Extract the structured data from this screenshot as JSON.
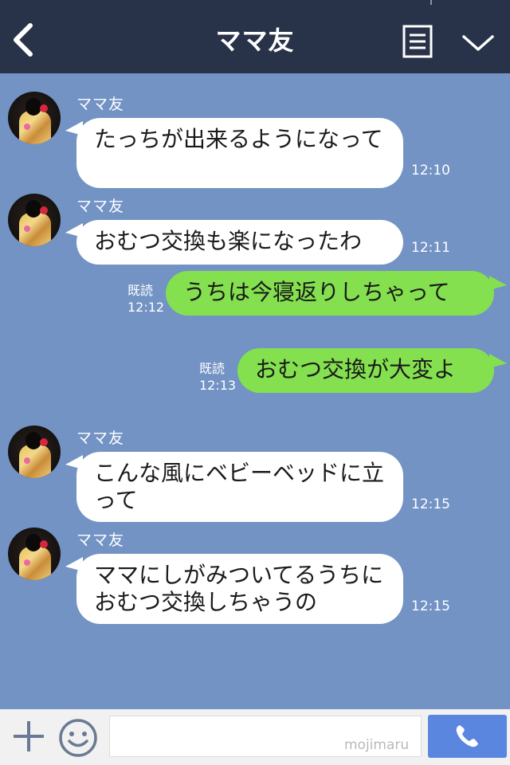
{
  "header": {
    "title": "ママ友",
    "icons": {
      "back": "back-chevron-icon",
      "menu": "document-menu-icon",
      "collapse": "chevron-down-icon"
    }
  },
  "messages": [
    {
      "side": "in",
      "sender": "ママ友",
      "text": "たっちが出来るようになって",
      "time": "12:10"
    },
    {
      "side": "in",
      "sender": "ママ友",
      "text": "おむつ交換も楽になったわ",
      "time": "12:11"
    },
    {
      "side": "out",
      "read": "既読",
      "text": "うちは今寝返りしちゃって",
      "time": "12:12"
    },
    {
      "side": "out",
      "read": "既読",
      "text": "おむつ交換が大変よ",
      "time": "12:13"
    },
    {
      "side": "in",
      "sender": "ママ友",
      "text": "こんな風にベビーベッドに立って",
      "time": "12:15"
    },
    {
      "side": "in",
      "sender": "ママ友",
      "text": "ママにしがみついてるうちにおむつ交換しちゃうの",
      "time": "12:15"
    }
  ],
  "input": {
    "value": "",
    "watermark": "mojimaru",
    "icons": {
      "plus": "plus-icon",
      "emoji": "smiley-icon",
      "call": "phone-icon"
    }
  },
  "colors": {
    "header_bg": "#283249",
    "chat_bg": "#7293c4",
    "incoming_bubble": "#ffffff",
    "outgoing_bubble": "#84e04f",
    "call_button": "#5a86df"
  }
}
